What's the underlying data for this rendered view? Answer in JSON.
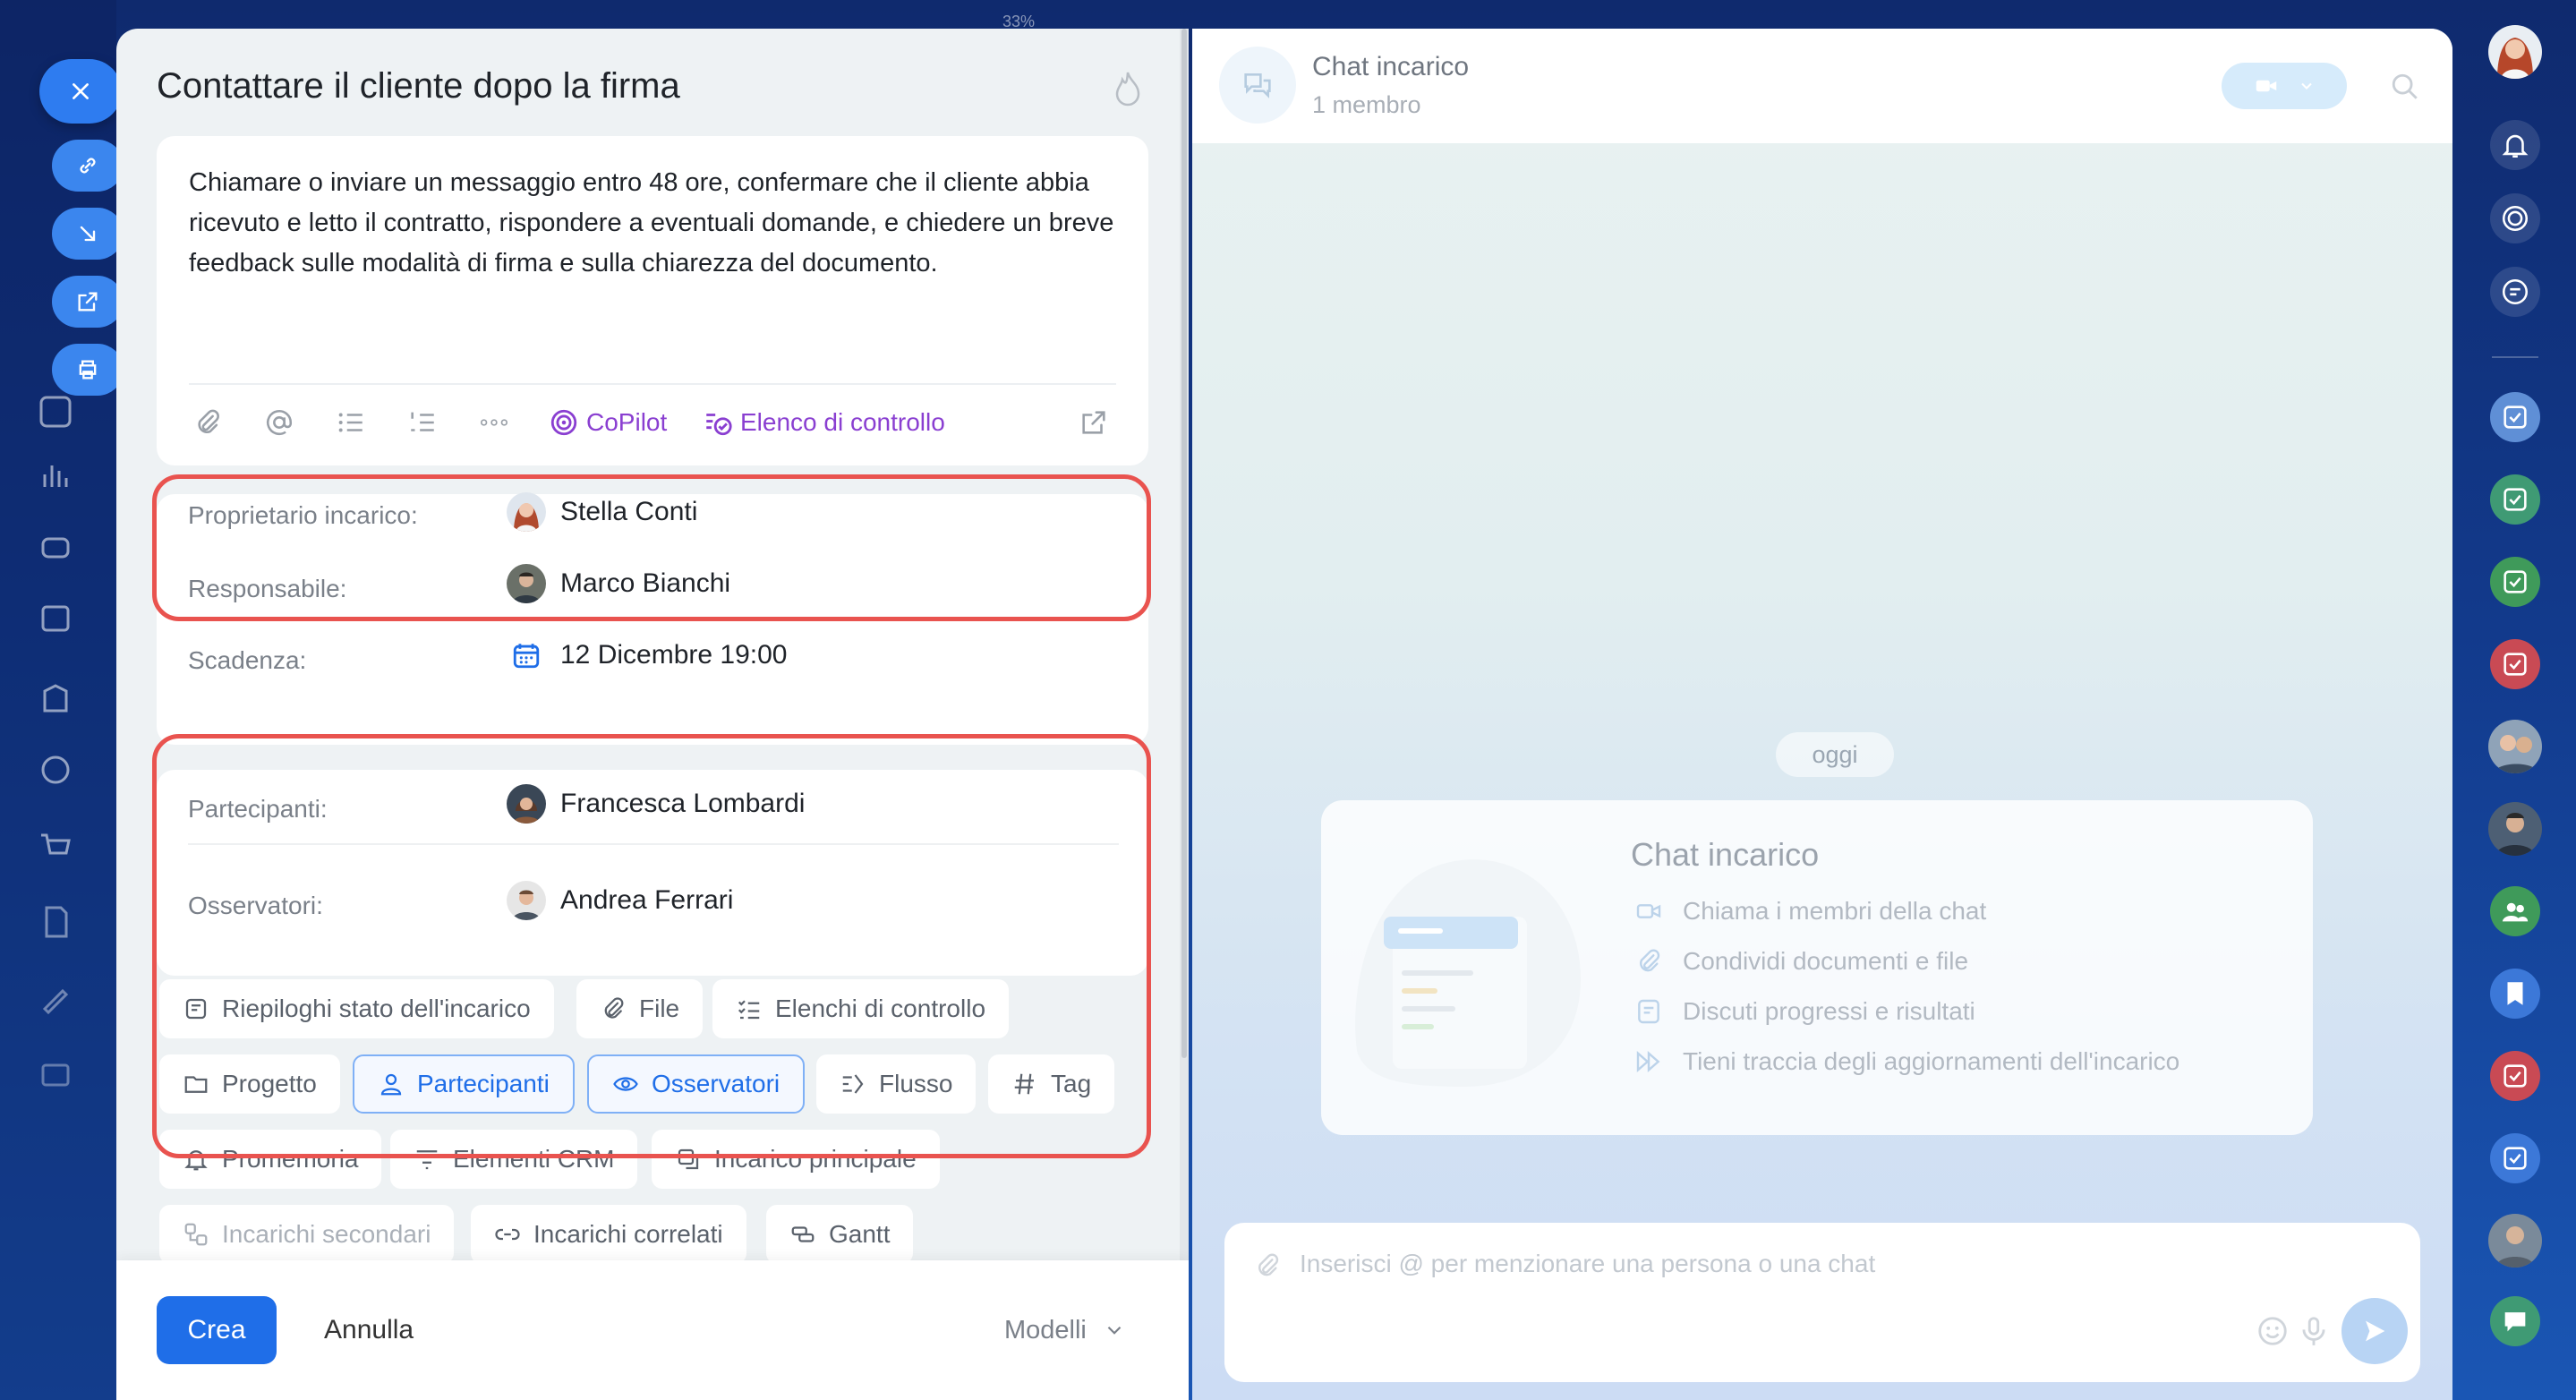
{
  "task": {
    "title": "Contattare il cliente dopo la firma",
    "description": "Chiamare o inviare un messaggio entro 48 ore, confermare che il cliente abbia ricevuto e letto il contratto, rispondere a eventuali domande, e chiedere un breve feedback sulle modalità di firma e sulla chiarezza del documento.",
    "toolbar": {
      "copilot": "CoPilot",
      "checklist": "Elenco di controllo"
    },
    "fields": {
      "owner_label": "Proprietario incarico:",
      "owner_value": "Stella Conti",
      "responsible_label": "Responsabile:",
      "responsible_value": "Marco Bianchi",
      "deadline_label": "Scadenza:",
      "deadline_value": "12 Dicembre 19:00",
      "participants_label": "Partecipanti:",
      "participants_value": "Francesca Lombardi",
      "observers_label": "Osservatori:",
      "observers_value": "Andrea Ferrari"
    },
    "chips": {
      "status_summary": "Riepiloghi stato dell'incarico",
      "file": "File",
      "checklists": "Elenchi di controllo",
      "project": "Progetto",
      "participants": "Partecipanti",
      "observers": "Osservatori",
      "flow": "Flusso",
      "tag": "Tag",
      "reminder": "Promemoria",
      "crm": "Elementi CRM",
      "parent_task": "Incarico principale",
      "subtasks": "Incarichi secondari",
      "related_tasks": "Incarichi correlati",
      "gantt": "Gantt"
    },
    "footer": {
      "create": "Crea",
      "cancel": "Annulla",
      "templates": "Modelli"
    }
  },
  "chat": {
    "title": "Chat incarico",
    "subtitle": "1 membro",
    "date_divider": "oggi",
    "welcome_title": "Chat incarico",
    "features": [
      "Chiama i membri della chat",
      "Condividi documenti e file",
      "Discuti progressi e risultati",
      "Tieni traccia degli aggiornamenti dell'incarico"
    ],
    "input_placeholder": "Inserisci @ per menzionare una persona o una chat"
  },
  "background": {
    "progress_label": "33%"
  },
  "colors": {
    "accent": "#1f6ee8",
    "highlight": "#e9534f",
    "copilot": "#8a3fd1"
  }
}
